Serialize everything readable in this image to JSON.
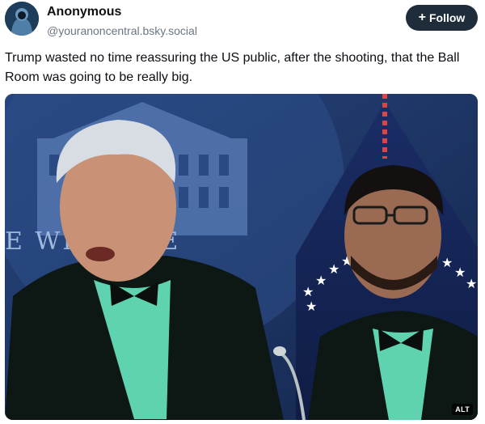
{
  "author": {
    "display_name": "Anonymous",
    "handle": "@youranoncentral.bsky.social"
  },
  "follow_button": {
    "label": "Follow",
    "icon": "plus-icon"
  },
  "post": {
    "text": "Trump wasted no time reassuring the US public, after the shooting, that the Ball Room was going to be really big."
  },
  "media": {
    "backdrop_text": "E WH          OUSE",
    "alt_badge": "ALT"
  },
  "colors": {
    "follow_bg": "#1f2d3b",
    "handle": "#6b7684",
    "backdrop_blue": "#1f3a6e",
    "suit": "#0d1714",
    "shirt_green": "#5fd3b0"
  }
}
